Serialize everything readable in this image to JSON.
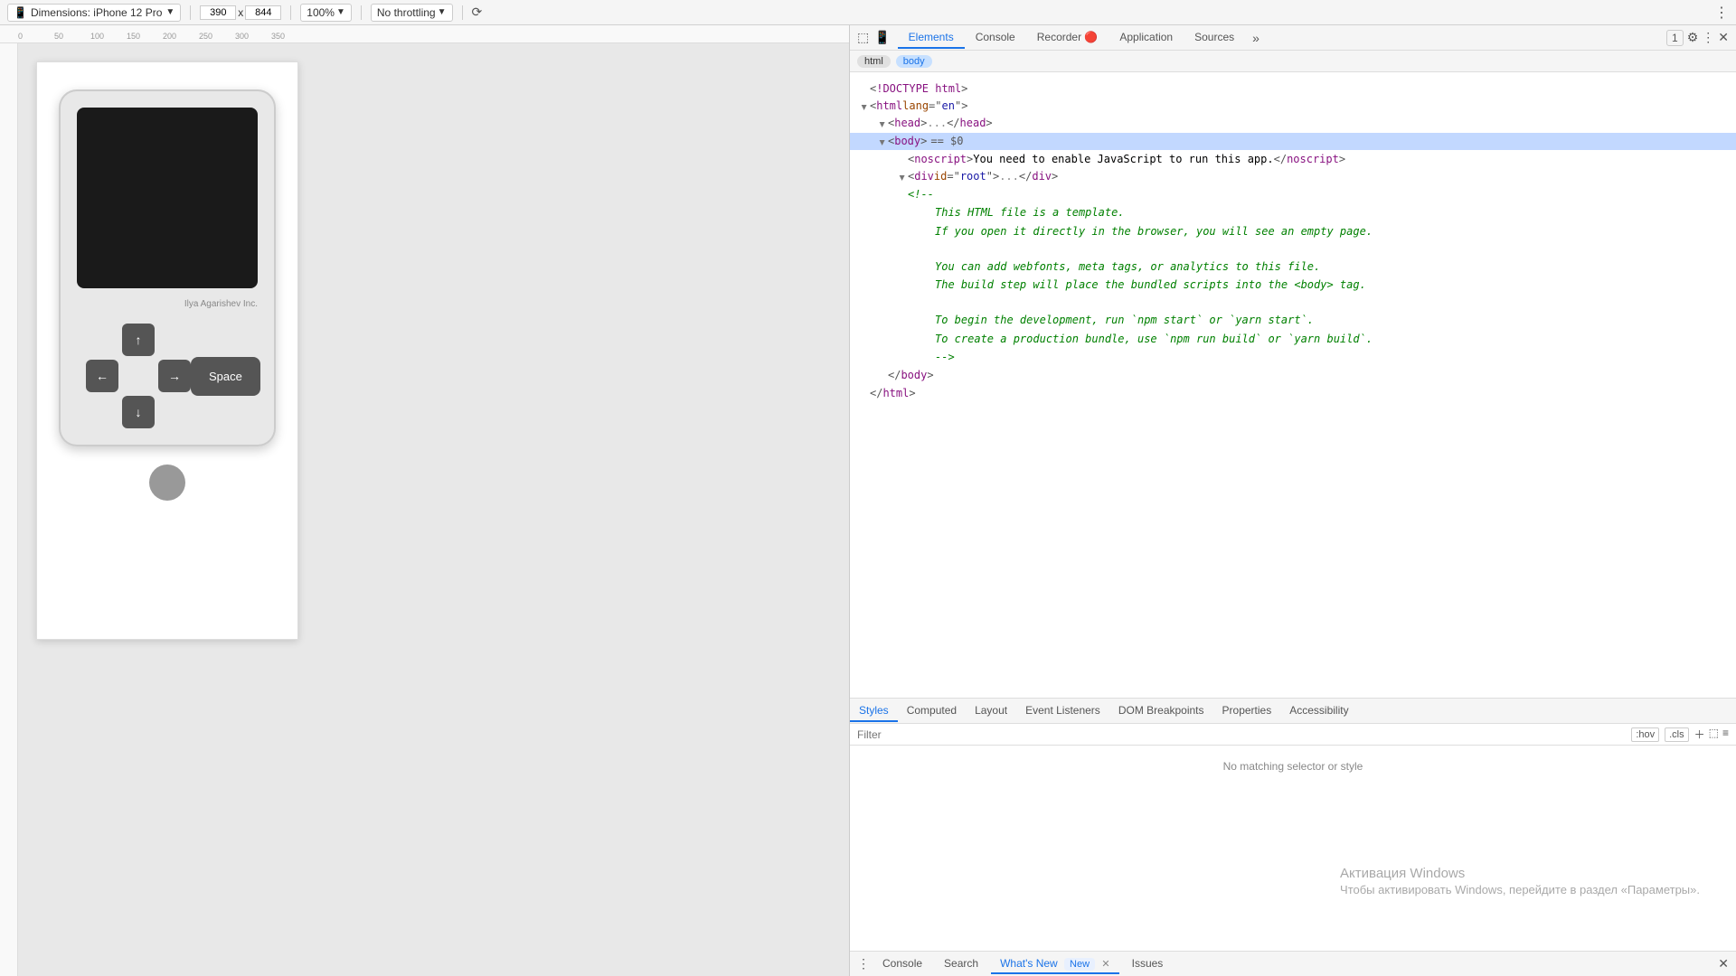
{
  "toolbar": {
    "device_label": "Dimensions: iPhone 12 Pro",
    "width": "390",
    "height": "844",
    "zoom": "100%",
    "throttle": "No throttling",
    "rotate_icon": "⟳"
  },
  "devtools": {
    "tabs": [
      "Elements",
      "Console",
      "Recorder 🔴",
      "Application",
      "Sources",
      "»"
    ],
    "active_tab": "Elements",
    "selector_tabs": [
      "html",
      "body"
    ],
    "style_tabs": [
      "Styles",
      "Computed",
      "Layout",
      "Event Listeners",
      "DOM Breakpoints",
      "Properties",
      "Accessibility"
    ],
    "active_style_tab": "Styles",
    "filter_placeholder": "Filter",
    "filter_hov": ":hov",
    "filter_cls": ".cls",
    "no_matching_text": "No matching selector or style"
  },
  "html_code": {
    "lines": [
      {
        "indent": 0,
        "content": "<!DOCTYPE html>",
        "type": "doctype"
      },
      {
        "indent": 0,
        "content": "<html lang=\"en\">",
        "type": "tag-open",
        "expandable": true
      },
      {
        "indent": 1,
        "content": "<head>...</head>",
        "type": "tag-collapsed"
      },
      {
        "indent": 1,
        "content": "<body> == $0",
        "type": "tag-open-selected",
        "expandable": true
      },
      {
        "indent": 2,
        "content": "<noscript>You need to enable JavaScript to run this app.</noscript>",
        "type": "tag"
      },
      {
        "indent": 2,
        "content": "<div id=\"root\">...</div>",
        "type": "tag-collapsed"
      },
      {
        "indent": 2,
        "content": "<!--",
        "type": "comment-open"
      },
      {
        "indent": 3,
        "content": "This HTML file is a template.",
        "type": "comment-text"
      },
      {
        "indent": 3,
        "content": "If you open it directly in the browser, you will see an empty page.",
        "type": "comment-text"
      },
      {
        "indent": 0,
        "content": "",
        "type": "blank"
      },
      {
        "indent": 3,
        "content": "You can add webfonts, meta tags, or analytics to this file.",
        "type": "comment-text"
      },
      {
        "indent": 3,
        "content": "The build step will place the bundled scripts into the <body> tag.",
        "type": "comment-text"
      },
      {
        "indent": 0,
        "content": "",
        "type": "blank"
      },
      {
        "indent": 3,
        "content": "To begin the development, run `npm start` or `yarn start`.",
        "type": "comment-text"
      },
      {
        "indent": 3,
        "content": "To create a production bundle, use `npm run build` or `yarn build`.",
        "type": "comment-text"
      },
      {
        "indent": 3,
        "content": "-->",
        "type": "comment-close"
      },
      {
        "indent": 1,
        "content": "</body>",
        "type": "tag-close"
      },
      {
        "indent": 0,
        "content": "</html>",
        "type": "tag-close"
      }
    ]
  },
  "phone": {
    "credit": "Ilya Agarishev Inc.",
    "buttons": {
      "up": "↑",
      "left": "←",
      "right": "→",
      "down": "↓",
      "space": "Space"
    }
  },
  "windows_activation": {
    "title": "Активация Windows",
    "subtitle": "Чтобы активировать Windows, перейдите в раздел «Параметры»."
  },
  "console_bar": {
    "tabs": [
      "Console",
      "Search",
      "What's New",
      "Issues"
    ],
    "active_tab": "What's New",
    "new_badge": "New",
    "notification_count": "1"
  }
}
